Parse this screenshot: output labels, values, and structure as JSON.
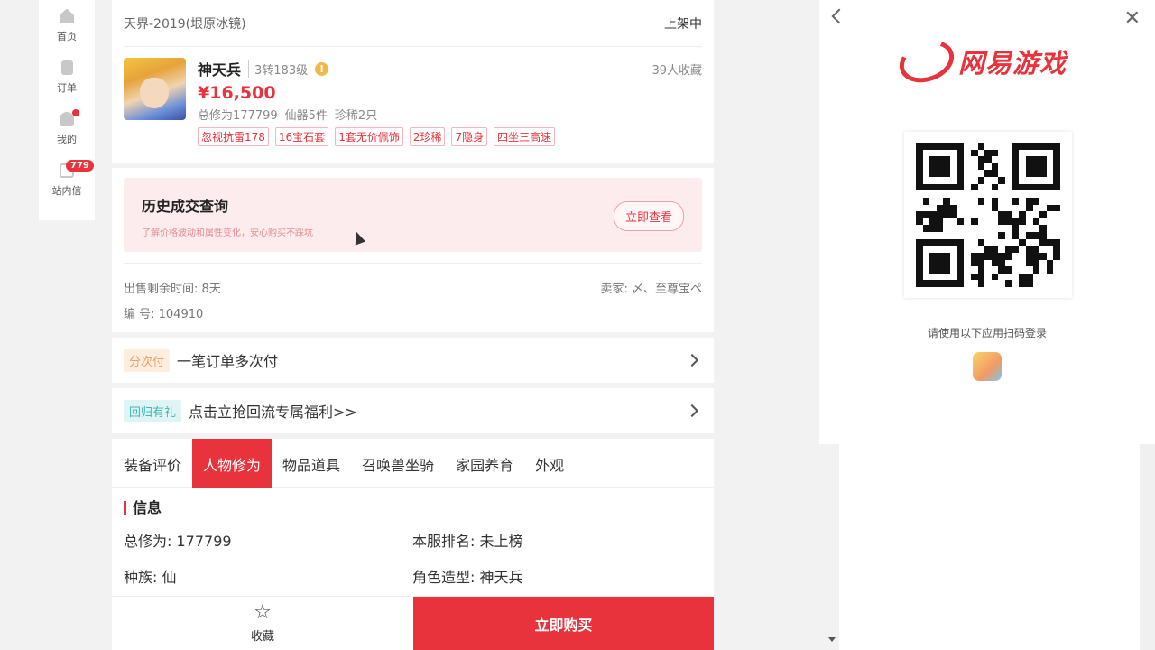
{
  "nav": {
    "items": [
      {
        "label": "首页",
        "icon": "home-icon"
      },
      {
        "label": "订单",
        "icon": "order-icon"
      },
      {
        "label": "我的",
        "icon": "user-icon"
      },
      {
        "label": "站内信",
        "icon": "mail-icon",
        "badge": "779"
      }
    ]
  },
  "product": {
    "server": "天界-2019(垠原冰镜)",
    "status": "上架中",
    "name": "神天兵",
    "level": "3转183级",
    "fav_count": "39人收藏",
    "price": "¥16,500",
    "stats": [
      "总修为177799",
      "仙器5件",
      "珍稀2只"
    ],
    "tags": [
      "忽视抗雷178",
      "16宝石套",
      "1套无价佩饰",
      "2珍稀",
      "7隐身",
      "四坐三高速"
    ]
  },
  "history": {
    "title": "历史成交查询",
    "subtitle": "了解价格波动和属性变化，安心购买不踩坑",
    "button": "立即查看"
  },
  "sale": {
    "remaining": "出售剩余时间: 8天",
    "seller": "卖家: 〆、至尊宝ペ",
    "serial": "编  号: 104910"
  },
  "promo1": {
    "pill": "分次付",
    "text": "一笔订单多次付"
  },
  "promo2": {
    "pill": "回归有礼",
    "text": "点击立抢回流专属福利>>"
  },
  "tabs": [
    "装备评价",
    "人物修为",
    "物品道具",
    "召唤兽坐骑",
    "家园养育",
    "外观"
  ],
  "active_tab": 1,
  "section": {
    "title": "信息",
    "fields": [
      "总修为:  177799",
      "本服排名:  未上榜",
      "种族:  仙",
      "角色造型:  神天兵"
    ]
  },
  "bottom": {
    "fav": "收藏",
    "buy": "立即购买"
  },
  "login": {
    "brand": "网易游戏",
    "hint": "请使用以下应用扫码登录"
  }
}
